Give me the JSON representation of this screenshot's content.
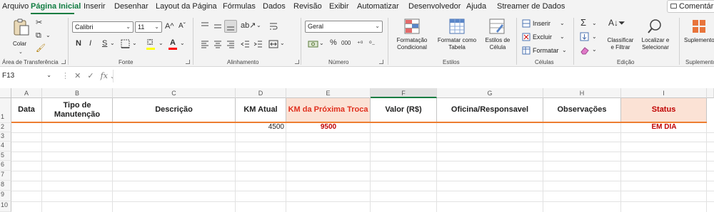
{
  "menu": {
    "tabs": [
      "Arquivo",
      "Página Inicial",
      "Inserir",
      "Desenhar",
      "Layout da Página",
      "Fórmulas",
      "Dados",
      "Revisão",
      "Exibir",
      "Automatizar",
      "Desenvolvedor",
      "Ajuda",
      "Streamer de Dados"
    ],
    "active_tab": "Página Inicial",
    "comments_label": "Comentários"
  },
  "ribbon": {
    "clipboard": {
      "paste_label": "Colar",
      "group_label": "Área de Transferência"
    },
    "font": {
      "name": "Calibri",
      "size": "11",
      "bold": "N",
      "italic": "I",
      "underline": "S",
      "grow": "A^",
      "shrink": "Aˇ",
      "color_letter": "A",
      "group_label": "Fonte"
    },
    "alignment": {
      "group_label": "Alinhamento"
    },
    "number": {
      "format": "Geral",
      "percent": "%",
      "comma": "000",
      "group_label": "Número"
    },
    "styles": {
      "cond_format_label": "Formatação\nCondicional",
      "format_table_label": "Formatar como\nTabela",
      "cell_styles_label": "Estilos de\nCélula",
      "group_label": "Estilos"
    },
    "cells": {
      "insert_label": "Inserir",
      "delete_label": "Excluir",
      "format_label": "Formatar",
      "group_label": "Células"
    },
    "editing": {
      "sort_label": "Classificar\ne Filtrar",
      "find_label": "Localizar e\nSelecionar",
      "group_label": "Edição"
    },
    "addins": {
      "label": "Suplementos",
      "group_label": "Suplemento"
    }
  },
  "formula_bar": {
    "cell_ref": "F13",
    "fx": "fx",
    "cancel": "✕",
    "confirm": "✓",
    "formula": ""
  },
  "sheet": {
    "columns": [
      "A",
      "B",
      "C",
      "D",
      "E",
      "F",
      "G",
      "H",
      "I"
    ],
    "selected_column": "F",
    "rows": [
      "1",
      "2",
      "3",
      "4",
      "5",
      "6",
      "7",
      "8",
      "9",
      "10"
    ],
    "headers": [
      "Data",
      "Tipo de\nManutenção",
      "Descrição",
      "KM Atual",
      "KM da Próxima Troca",
      "Valor (R$)",
      "Oficina/Responsavel",
      "Observações",
      "Status"
    ],
    "row2": {
      "km_atual": "4500",
      "km_proxima": "9500",
      "status": "EM DIA"
    }
  },
  "colors": {
    "accent_green": "#107c41",
    "header_orange": "#fbe2d5",
    "status_red": "#c00000",
    "header_line": "#ed7d31"
  }
}
